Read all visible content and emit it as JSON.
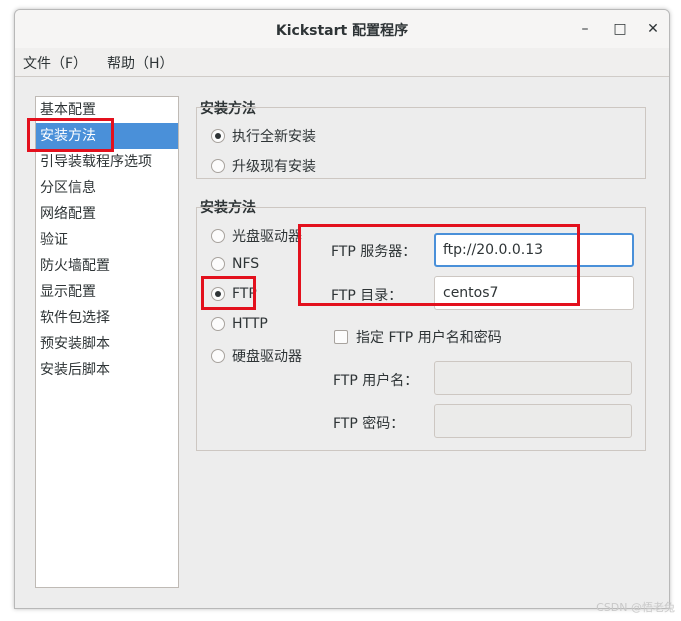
{
  "window": {
    "title": "Kickstart 配置程序",
    "minimize": "–",
    "maximize": "□",
    "close": "✕"
  },
  "menu": [
    {
      "label": "文件（F）"
    },
    {
      "label": "帮助（H）"
    }
  ],
  "sidebar": {
    "items": [
      {
        "label": "基本配置"
      },
      {
        "label": "安装方法",
        "selected": true
      },
      {
        "label": "引导装载程序选项"
      },
      {
        "label": "分区信息"
      },
      {
        "label": "网络配置"
      },
      {
        "label": "验证"
      },
      {
        "label": "防火墙配置"
      },
      {
        "label": "显示配置"
      },
      {
        "label": "软件包选择"
      },
      {
        "label": "预安装脚本"
      },
      {
        "label": "安装后脚本"
      }
    ]
  },
  "install_group": {
    "title": "安装方法",
    "options": [
      {
        "label": "执行全新安装",
        "checked": true
      },
      {
        "label": "升级现有安装",
        "checked": false
      }
    ]
  },
  "source_group": {
    "title": "安装方法",
    "options": [
      {
        "label": "光盘驱动器",
        "checked": false
      },
      {
        "label": "NFS",
        "checked": false
      },
      {
        "label": "FTP",
        "checked": true
      },
      {
        "label": "HTTP",
        "checked": false
      },
      {
        "label": "硬盘驱动器",
        "checked": false
      }
    ]
  },
  "ftp": {
    "server_label": "FTP 服务器：",
    "server_value": "ftp://20.0.0.13",
    "dir_label": "FTP 目录：",
    "dir_value": "centos7",
    "auth_label": "指定  FTP 用户名和密码",
    "auth_checked": false,
    "user_label": "FTP 用户名：",
    "user_value": "",
    "pass_label": "FTP 密码：",
    "pass_value": ""
  },
  "watermark": "CSDN @悟老兔",
  "colors": {
    "selection": "#4a90d9",
    "highlight": "#e3101d"
  }
}
